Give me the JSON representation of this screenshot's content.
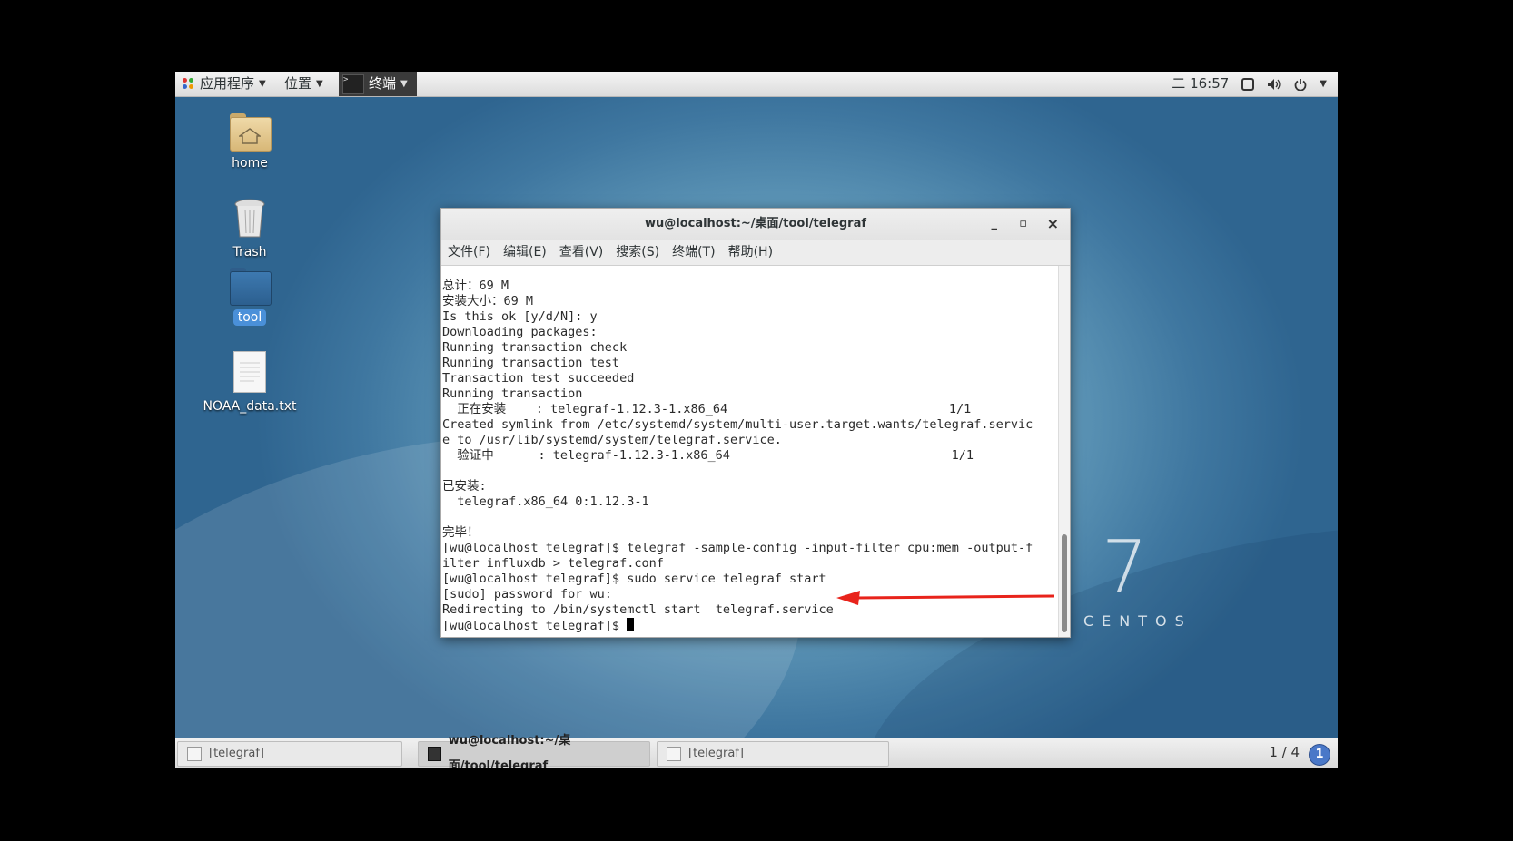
{
  "topbar": {
    "apps_label": "应用程序",
    "places_label": "位置",
    "terminal_label": "终端",
    "clock": "二 16:57",
    "icons": [
      "apps-icon",
      "display-icon",
      "volume-icon",
      "power-icon"
    ]
  },
  "desktop": {
    "icons": [
      {
        "label": "home",
        "icon": "home-folder-icon"
      },
      {
        "label": "Trash",
        "icon": "trash-icon"
      },
      {
        "label": "tool",
        "icon": "folder-icon"
      },
      {
        "label": "NOAA_data.txt",
        "icon": "text-file-icon"
      }
    ],
    "centos_number": "7",
    "centos_text": "CENTOS"
  },
  "window": {
    "title": "wu@localhost:~/桌面/tool/telegraf",
    "controls": {
      "minimize": "_",
      "maximize": "▫",
      "close": "×"
    },
    "menu": [
      "文件(F)",
      "编辑(E)",
      "查看(V)",
      "搜索(S)",
      "终端(T)",
      "帮助(H)"
    ],
    "terminal_lines": [
      "总计：69 M",
      "安装大小：69 M",
      "Is this ok [y/d/N]: y",
      "Downloading packages:",
      "Running transaction check",
      "Running transaction test",
      "Transaction test succeeded",
      "Running transaction",
      "  正在安装    : telegraf-1.12.3-1.x86_64                              1/1",
      "Created symlink from /etc/systemd/system/multi-user.target.wants/telegraf.servic",
      "e to /usr/lib/systemd/system/telegraf.service.",
      "  验证中      : telegraf-1.12.3-1.x86_64                              1/1",
      "",
      "已安装:",
      "  telegraf.x86_64 0:1.12.3-1",
      "",
      "完毕！",
      "[wu@localhost telegraf]$ telegraf -sample-config -input-filter cpu:mem -output-f",
      "ilter influxdb > telegraf.conf",
      "[wu@localhost telegraf]$ sudo service telegraf start",
      "[sudo] password for wu:",
      "Redirecting to /bin/systemctl start  telegraf.service"
    ],
    "prompt": "[wu@localhost telegraf]$ "
  },
  "taskbar": {
    "tasks": [
      {
        "label": "[telegraf]",
        "active": false
      },
      {
        "label": "wu@localhost:~/桌面/tool/telegraf",
        "active": true
      },
      {
        "label": "[telegraf]",
        "active": false
      }
    ],
    "pager": "1 / 4",
    "notification_count": "1"
  },
  "colors": {
    "accent": "#4a90d9",
    "annotation_arrow": "#e8231b",
    "desktop_bg": "#3f77a0"
  }
}
